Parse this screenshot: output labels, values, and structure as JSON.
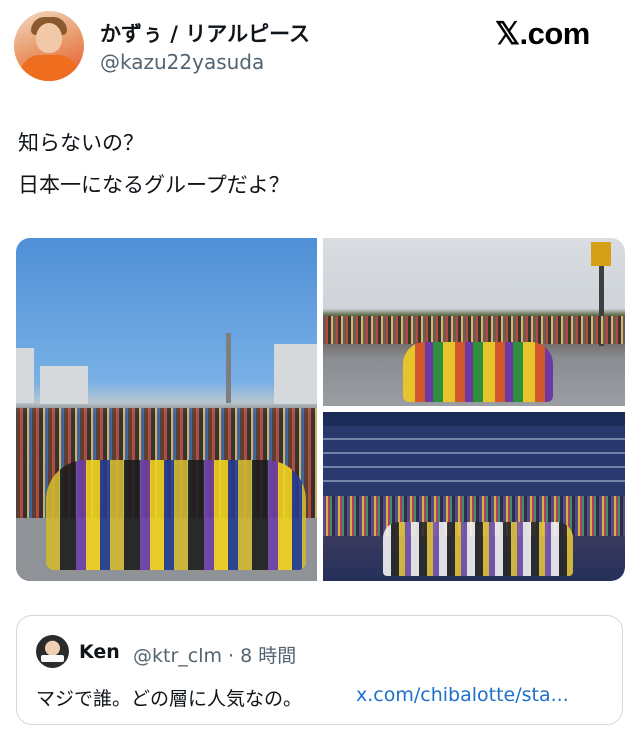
{
  "header": {
    "display_name": "かずぅ / リアルピース",
    "handle": "@kazu22yasuda",
    "site_logo": "𝕏.com"
  },
  "post": {
    "lines": [
      "知らないの？",
      "日本一になるグループだよ？"
    ]
  },
  "quoted_post": {
    "name": "Ken",
    "meta": "@ktr_clm · 8 時間",
    "text": "マジで誰。どの層に人気なの。",
    "link": "x.com/chibalotte/sta..."
  },
  "colors": {
    "text": "#0f1419",
    "secondary_text": "#536471",
    "link": "#1d6fc9",
    "border": "#cfd9de"
  }
}
